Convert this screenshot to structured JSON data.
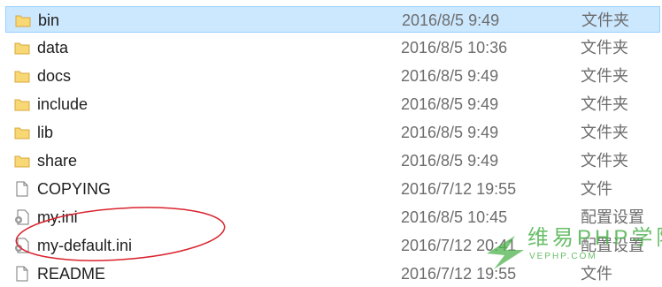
{
  "files": [
    {
      "name": "bin",
      "date": "2016/8/5 9:49",
      "type": "文件夹",
      "icon": "folder-icon",
      "selected": true
    },
    {
      "name": "data",
      "date": "2016/8/5 10:36",
      "type": "文件夹",
      "icon": "folder-icon"
    },
    {
      "name": "docs",
      "date": "2016/8/5 9:49",
      "type": "文件夹",
      "icon": "folder-icon"
    },
    {
      "name": "include",
      "date": "2016/8/5 9:49",
      "type": "文件夹",
      "icon": "folder-icon"
    },
    {
      "name": "lib",
      "date": "2016/8/5 9:49",
      "type": "文件夹",
      "icon": "folder-icon"
    },
    {
      "name": "share",
      "date": "2016/8/5 9:49",
      "type": "文件夹",
      "icon": "folder-icon"
    },
    {
      "name": "COPYING",
      "date": "2016/7/12 19:55",
      "type": "文件",
      "icon": "file-icon"
    },
    {
      "name": "my.ini",
      "date": "2016/8/5 10:45",
      "type": "配置设置",
      "icon": "settings-file-icon"
    },
    {
      "name": "my-default.ini",
      "date": "2016/7/12 20:41",
      "type": "配置设置",
      "icon": "settings-file-icon"
    },
    {
      "name": "README",
      "date": "2016/7/12 19:55",
      "type": "文件",
      "icon": "file-icon"
    }
  ],
  "colors": {
    "selection_bg": "#cce8ff",
    "selection_border": "#99d1ff",
    "folder": "#f8d775",
    "annotation_circle": "#d9232e",
    "watermark_green": "#4fb34f"
  },
  "watermark": {
    "main": "维易PHP学院",
    "sub": "VEPHP.COM"
  }
}
